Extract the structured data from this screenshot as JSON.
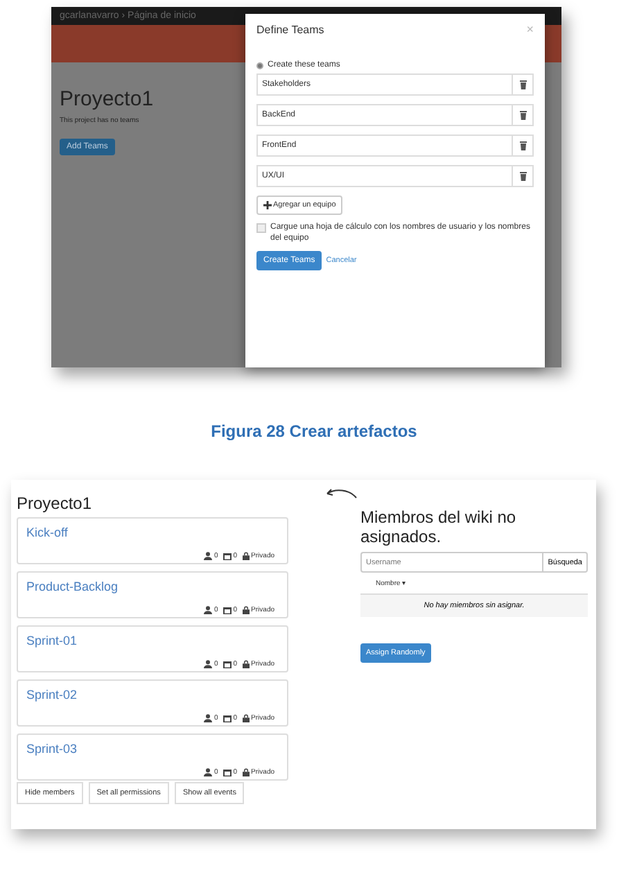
{
  "figure_1": {
    "topbar": {
      "breadcrumb": "gcarlanavarro › Página de inicio"
    },
    "background": {
      "title": "Proyecto1",
      "text": "This project has no teams",
      "button": "Add Teams"
    },
    "modal": {
      "title": "Define Teams",
      "close": "×",
      "option": {
        "label": "Create these teams",
        "selected": true
      },
      "teams": [
        {
          "value": "Stakeholders"
        },
        {
          "value": "BackEnd"
        },
        {
          "value": "FrontEnd"
        },
        {
          "value": "UX/UI"
        }
      ],
      "add_button": "Agregar un equipo",
      "upload": {
        "label": "Cargue una hoja de cálculo con los nombres de usuario y los nombres del equipo",
        "checked": false
      },
      "primary_button": "Create Teams",
      "cancel_link": "Cancelar"
    }
  },
  "caption": "Figura 28 Crear artefactos",
  "figure_2": {
    "title": "Proyecto1",
    "cards": [
      {
        "title": "Kick-off",
        "members": "0",
        "events": "0",
        "privacy": "Privado"
      },
      {
        "title": "Product-Backlog",
        "members": "0",
        "events": "0",
        "privacy": "Privado"
      },
      {
        "title": "Sprint-01",
        "members": "0",
        "events": "0",
        "privacy": "Privado"
      },
      {
        "title": "Sprint-02",
        "members": "0",
        "events": "0",
        "privacy": "Privado"
      },
      {
        "title": "Sprint-03",
        "members": "0",
        "events": "0",
        "privacy": "Privado"
      }
    ],
    "buttons": [
      "Hide members",
      "Set all permissions",
      "Show all events"
    ],
    "panel": {
      "title": "Miembros del wiki no asignados.",
      "search": {
        "placeholder": "Username",
        "button": "Búsqueda"
      },
      "column": "Nombre ▾",
      "empty": "No hay miembros sin asignar.",
      "button": "Assign Randomly"
    }
  }
}
